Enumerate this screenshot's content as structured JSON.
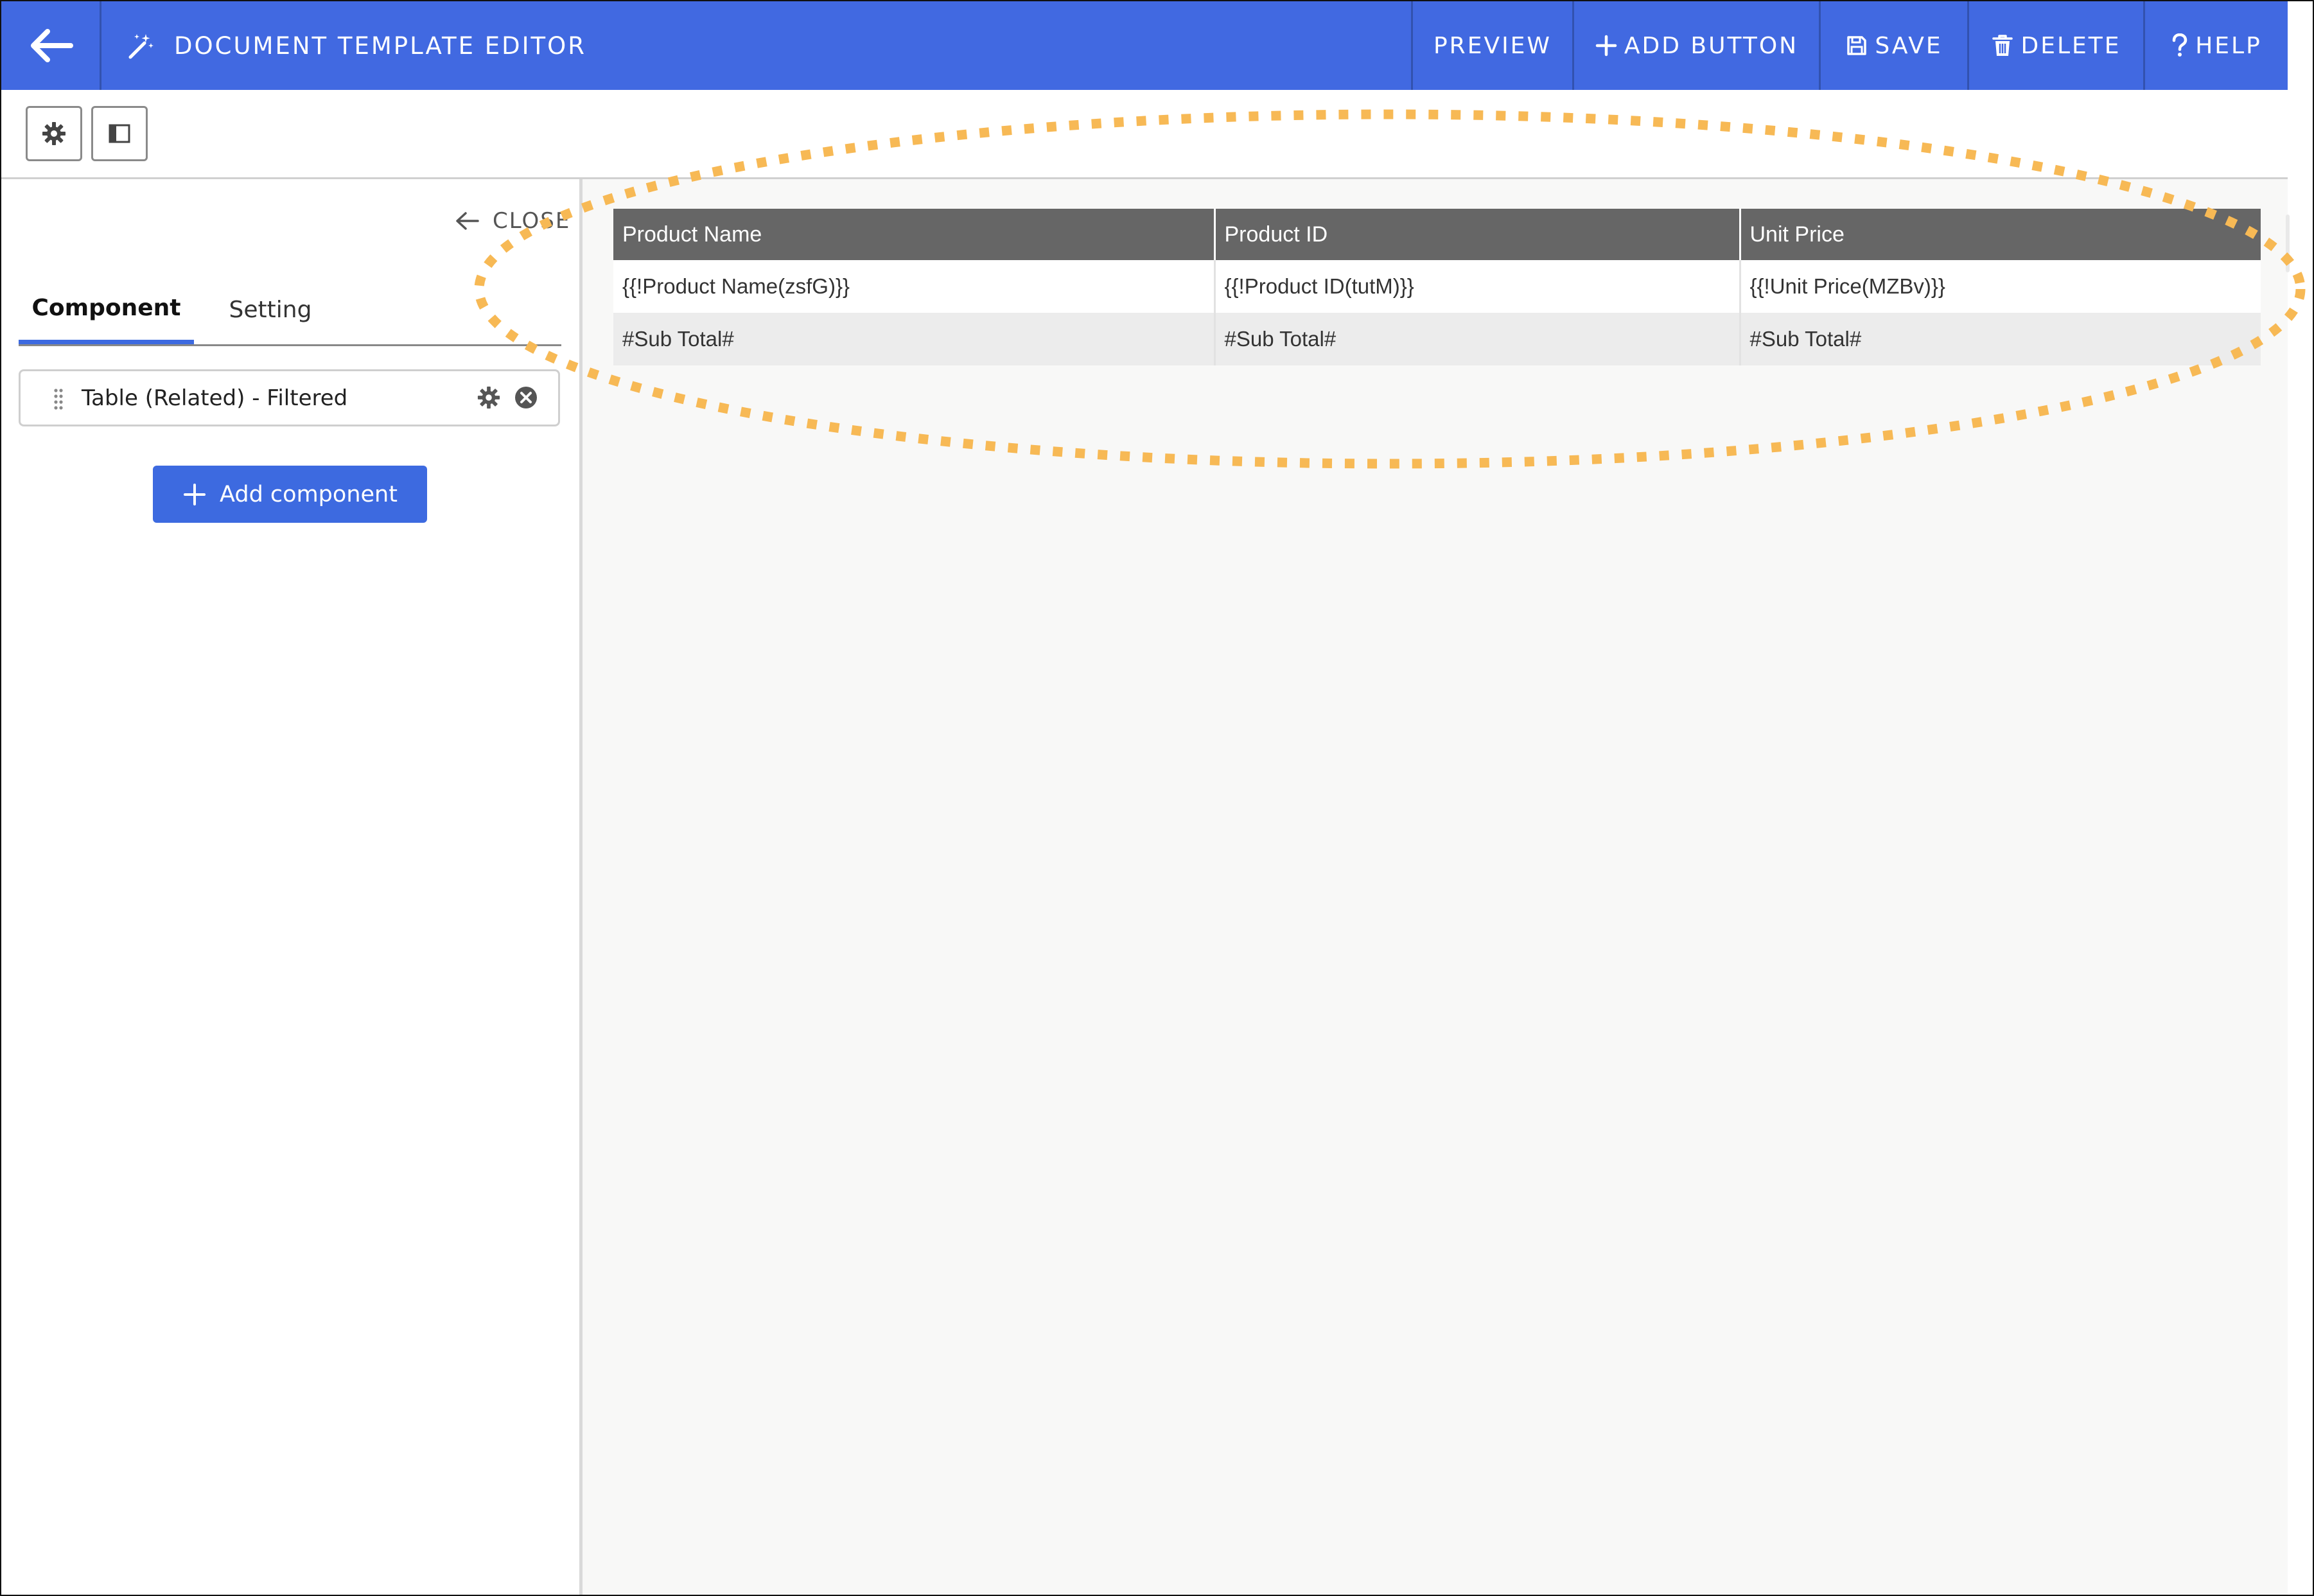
{
  "header": {
    "title": "DOCUMENT TEMPLATE EDITOR",
    "buttons": {
      "preview": "PREVIEW",
      "add_button": "ADD BUTTON",
      "save": "SAVE",
      "delete": "DELETE",
      "help": "HELP"
    }
  },
  "sidebar": {
    "close_label": "CLOSE",
    "tabs": [
      {
        "label": "Component",
        "active": true
      },
      {
        "label": "Setting",
        "active": false
      }
    ],
    "components": [
      {
        "label": "Table (Related) - Filtered"
      }
    ],
    "add_component_label": "Add component"
  },
  "table": {
    "headers": [
      "Product Name",
      "Product ID",
      "Unit Price"
    ],
    "rows": [
      [
        "{{!Product Name(zsfG)}}",
        "{{!Product ID(tutM)}}",
        "{{!Unit Price(MZBv)}}"
      ],
      [
        "#Sub Total#",
        "#Sub Total#",
        "#Sub Total#"
      ]
    ]
  },
  "colors": {
    "header_bg": "#4169e1",
    "accent": "#3d6ae0",
    "table_header_bg": "#666666",
    "highlight": "#f7b955"
  },
  "icons": {
    "back": "arrow-left-icon",
    "title": "magic-wand-icon",
    "add": "plus-icon",
    "save": "floppy-disk-icon",
    "delete": "trash-icon",
    "help": "question-mark-icon"
  }
}
